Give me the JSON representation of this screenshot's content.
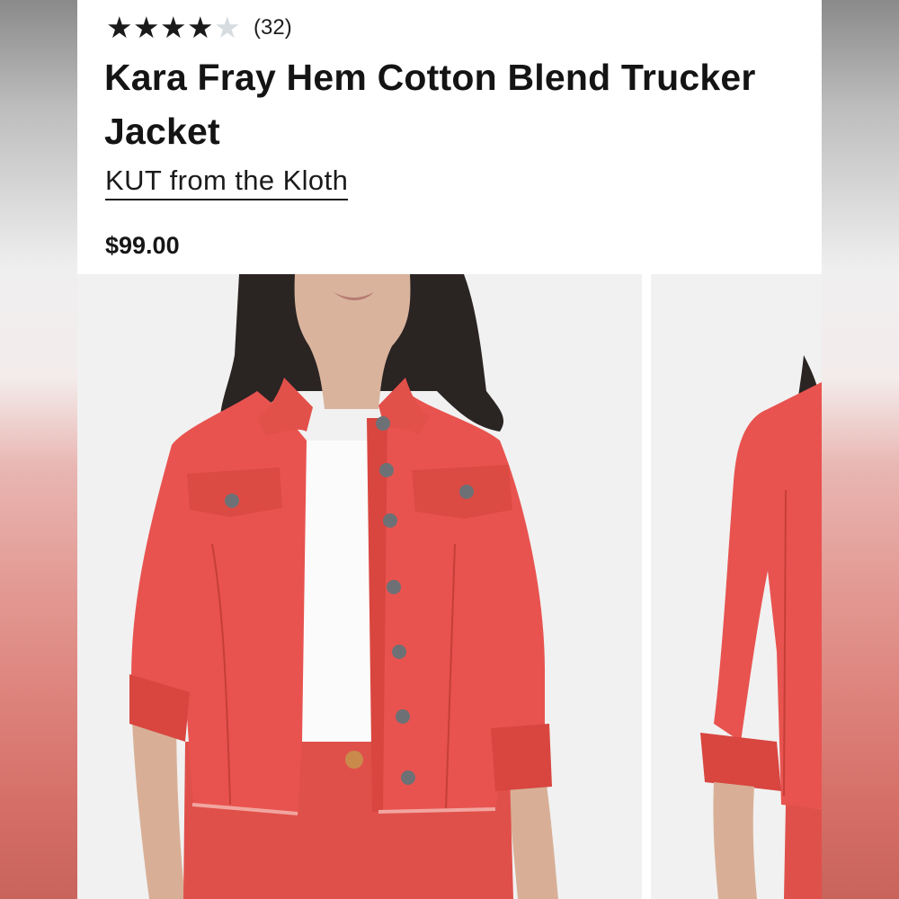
{
  "product": {
    "rating_value": 4,
    "rating_max": 5,
    "review_count": "(32)",
    "title": "Kara Fray Hem Cotton Blend Trucker Jacket",
    "brand": "KUT from the Kloth",
    "price": "$99.00"
  },
  "gallery": {
    "images": [
      {
        "name": "product-photo-front",
        "alt": "Kara Fray Hem Cotton Blend Trucker Jacket"
      },
      {
        "name": "product-photo-side",
        "alt": "Kara Fray Hem Cotton Blend Trucker Jacket"
      }
    ]
  },
  "colors": {
    "jacket": "#e8534f",
    "jacket_shadow": "#c9403d",
    "tee": "#fbfbfb",
    "hair": "#2a2423",
    "skin": "#d9b39c",
    "button": "#6d7175",
    "star_filled": "#1a1a1a",
    "star_empty": "#d6dde0"
  },
  "icons": {
    "star_filled": "star-filled-icon",
    "star_empty": "star-empty-icon"
  }
}
